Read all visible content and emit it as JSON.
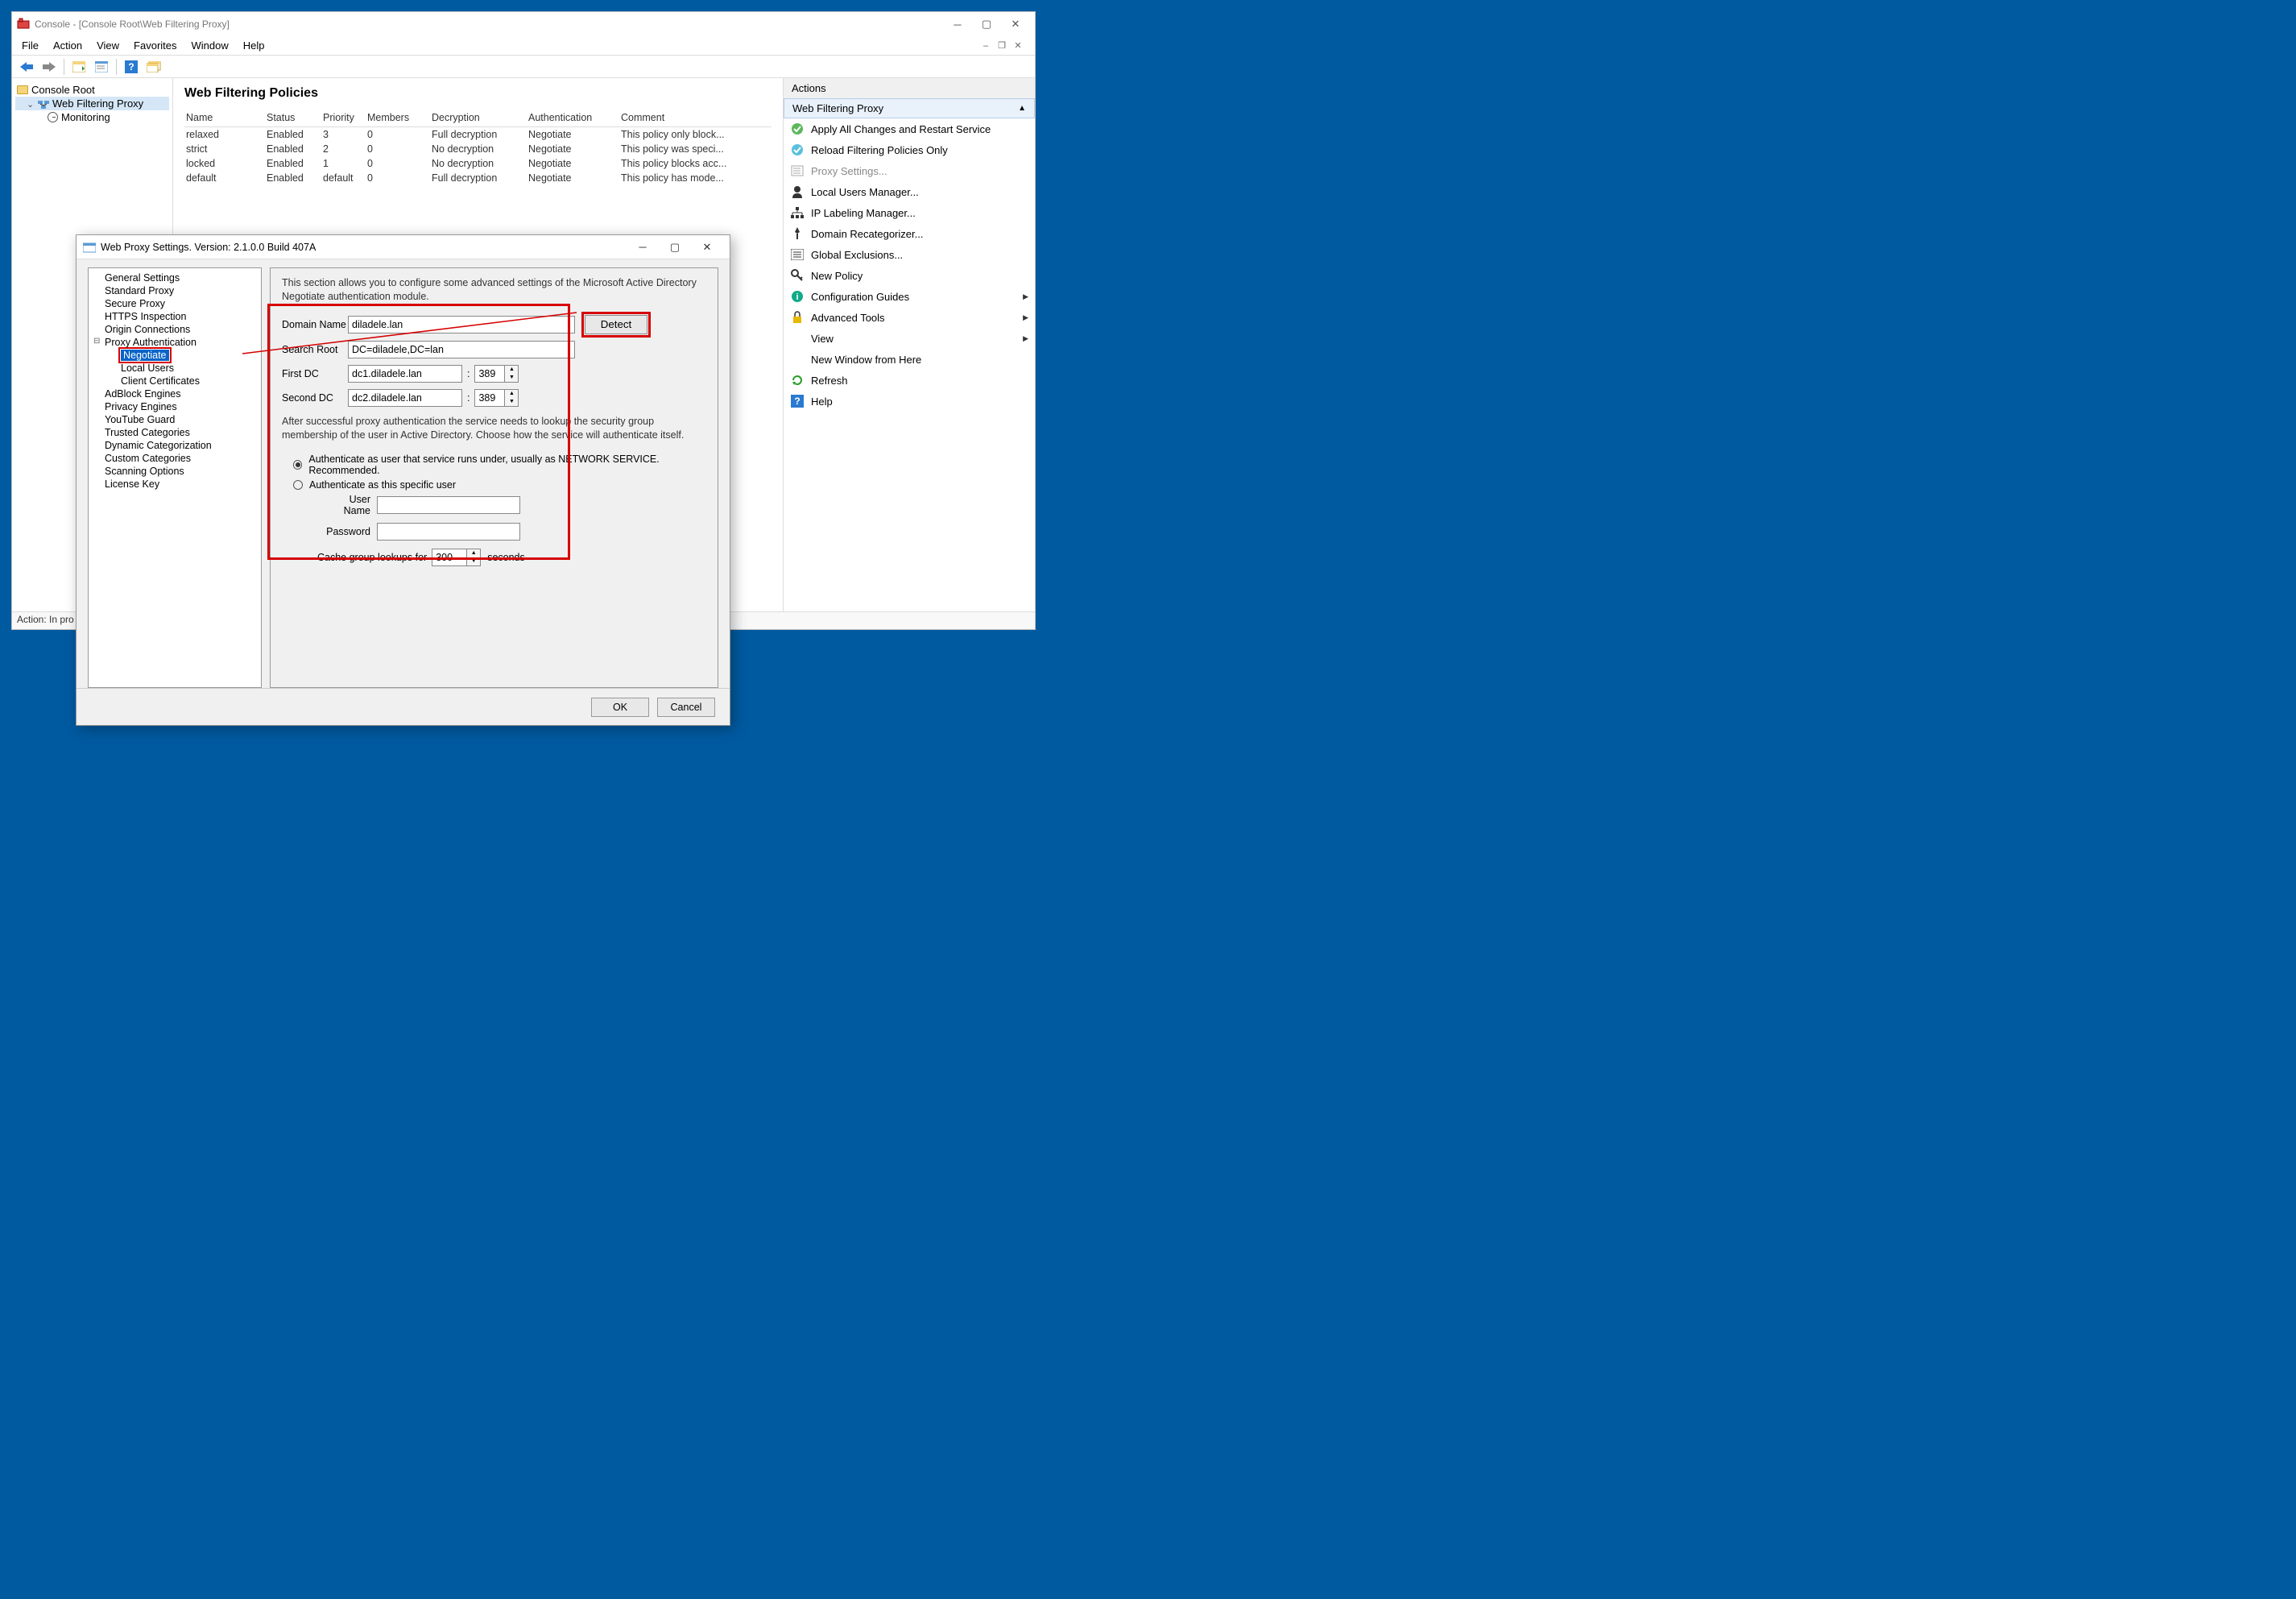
{
  "window": {
    "title": "Console - [Console Root\\Web Filtering Proxy]"
  },
  "menu": {
    "file": "File",
    "action": "Action",
    "view": "View",
    "favorites": "Favorites",
    "window": "Window",
    "help": "Help"
  },
  "tree": {
    "root": "Console Root",
    "proxy": "Web Filtering Proxy",
    "monitoring": "Monitoring"
  },
  "content": {
    "heading": "Web Filtering Policies",
    "columns": {
      "name": "Name",
      "status": "Status",
      "priority": "Priority",
      "members": "Members",
      "decryption": "Decryption",
      "auth": "Authentication",
      "comment": "Comment"
    },
    "rows": [
      {
        "name": "relaxed",
        "status": "Enabled",
        "priority": "3",
        "members": "0",
        "decryption": "Full decryption",
        "auth": "Negotiate",
        "comment": "This policy only block..."
      },
      {
        "name": "strict",
        "status": "Enabled",
        "priority": "2",
        "members": "0",
        "decryption": "No decryption",
        "auth": "Negotiate",
        "comment": "This policy was speci..."
      },
      {
        "name": "locked",
        "status": "Enabled",
        "priority": "1",
        "members": "0",
        "decryption": "No decryption",
        "auth": "Negotiate",
        "comment": "This policy blocks acc..."
      },
      {
        "name": "default",
        "status": "Enabled",
        "priority": "default",
        "members": "0",
        "decryption": "Full decryption",
        "auth": "Negotiate",
        "comment": "This policy has mode..."
      }
    ]
  },
  "actions": {
    "title": "Actions",
    "subtitle": "Web Filtering Proxy",
    "items": {
      "apply": "Apply All Changes and Restart Service",
      "reload": "Reload Filtering Policies Only",
      "proxy_settings": "Proxy Settings...",
      "local_users": "Local Users Manager...",
      "ip_label": "IP Labeling Manager...",
      "domain_recat": "Domain Recategorizer...",
      "global_excl": "Global Exclusions...",
      "new_policy": "New Policy",
      "config_guides": "Configuration Guides",
      "adv_tools": "Advanced Tools",
      "view": "View",
      "new_win": "New Window from Here",
      "refresh": "Refresh",
      "help": "Help"
    }
  },
  "status_bar": "Action:  In pro",
  "dialog": {
    "title": "Web Proxy Settings. Version: 2.1.0.0 Build 407A",
    "tree": {
      "general": "General Settings",
      "standard": "Standard Proxy",
      "secure": "Secure Proxy",
      "https": "HTTPS Inspection",
      "origin": "Origin Connections",
      "proxy_auth": "Proxy Authentication",
      "negotiate": "Negotiate",
      "local_users": "Local Users",
      "client_certs": "Client Certificates",
      "adblock": "AdBlock Engines",
      "privacy": "Privacy Engines",
      "youtube": "YouTube Guard",
      "trusted": "Trusted Categories",
      "dynamic": "Dynamic Categorization",
      "custom": "Custom Categories",
      "scanning": "Scanning Options",
      "license": "License Key"
    },
    "form": {
      "desc": "This section allows you to configure some advanced settings of the Microsoft Active Directory Negotiate authentication module.",
      "domain_label": "Domain Name",
      "domain_value": "diladele.lan",
      "detect": "Detect",
      "search_label": "Search Root",
      "search_value": "DC=diladele,DC=lan",
      "first_dc_label": "First DC",
      "first_dc_value": "dc1.diladele.lan",
      "first_dc_port": "389",
      "second_dc_label": "Second DC",
      "second_dc_value": "dc2.diladele.lan",
      "second_dc_port": "389",
      "lookup_desc": "After successful proxy authentication the service needs to lookup the security group membership of the user in Active Directory. Choose how the service will authenticate itself.",
      "radio1": "Authenticate as user that service runs under, usually as NETWORK SERVICE. Recommended.",
      "radio2": "Authenticate as this specific user",
      "user_label": "User Name",
      "user_value": "",
      "pass_label": "Password",
      "pass_value": "",
      "cache_pre": "Cache group lookups for",
      "cache_value": "300",
      "cache_post": "seconds",
      "ok": "OK",
      "cancel": "Cancel"
    }
  }
}
